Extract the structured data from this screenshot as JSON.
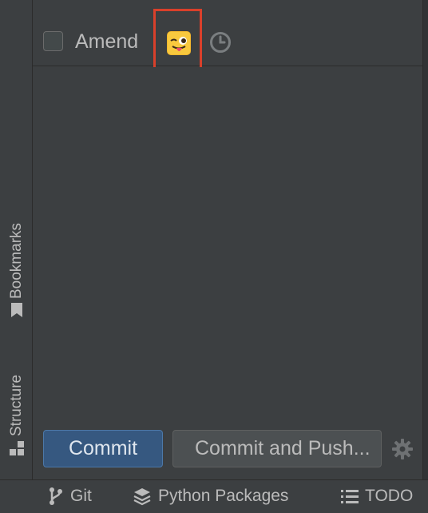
{
  "left_strip": {
    "tabs": [
      {
        "label": "Bookmarks",
        "icon": "bookmark-icon"
      },
      {
        "label": "Structure",
        "icon": "structure-icon"
      }
    ]
  },
  "commit_panel": {
    "amend_label": "Amend",
    "amend_checked": false,
    "emoji_icon": "winking-face-with-tongue-icon",
    "history_icon": "clock-icon",
    "commit_label": "Commit",
    "commit_push_label": "Commit and Push...",
    "settings_icon": "gear-icon"
  },
  "bottom_bar": {
    "tabs": [
      {
        "label": "Git",
        "icon": "branch-icon"
      },
      {
        "label": "Python Packages",
        "icon": "layers-icon"
      },
      {
        "label": "TODO",
        "icon": "list-icon"
      }
    ]
  },
  "colors": {
    "background": "#3c3f41",
    "primary_button": "#365880",
    "highlight_border": "#d9402b",
    "text": "#bbbbbb"
  }
}
